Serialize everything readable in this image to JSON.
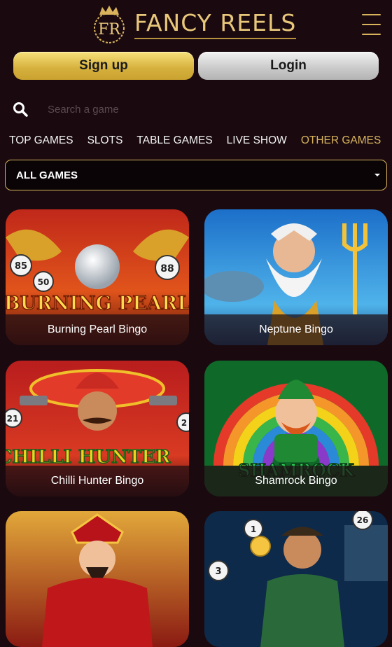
{
  "brand": {
    "name": "FANCY REELS",
    "monogram": "FR"
  },
  "auth": {
    "signup_label": "Sign up",
    "login_label": "Login"
  },
  "search": {
    "placeholder": "Search a game"
  },
  "tabs": [
    {
      "label": "TOP GAMES",
      "active": false
    },
    {
      "label": "SLOTS",
      "active": false
    },
    {
      "label": "TABLE GAMES",
      "active": false
    },
    {
      "label": "LIVE SHOW",
      "active": false
    },
    {
      "label": "OTHER GAMES",
      "active": true
    }
  ],
  "filter": {
    "selected": "ALL GAMES"
  },
  "colors": {
    "accent_gold": "#d9b45c",
    "background": "#1a0a10"
  },
  "games": [
    {
      "title": "Burning Pearl Bingo",
      "art_text": "BURNING PEARL",
      "balls": [
        "85",
        "50",
        "88"
      ]
    },
    {
      "title": "Neptune Bingo"
    },
    {
      "title": "Chilli Hunter Bingo",
      "art_text": "CHILLI HUNTER",
      "balls": [
        "21",
        "2"
      ]
    },
    {
      "title": "Shamrock Bingo",
      "art_text": "SHAMROCK"
    },
    {
      "title": ""
    },
    {
      "title": "",
      "balls": [
        "1",
        "3",
        "26"
      ]
    }
  ]
}
